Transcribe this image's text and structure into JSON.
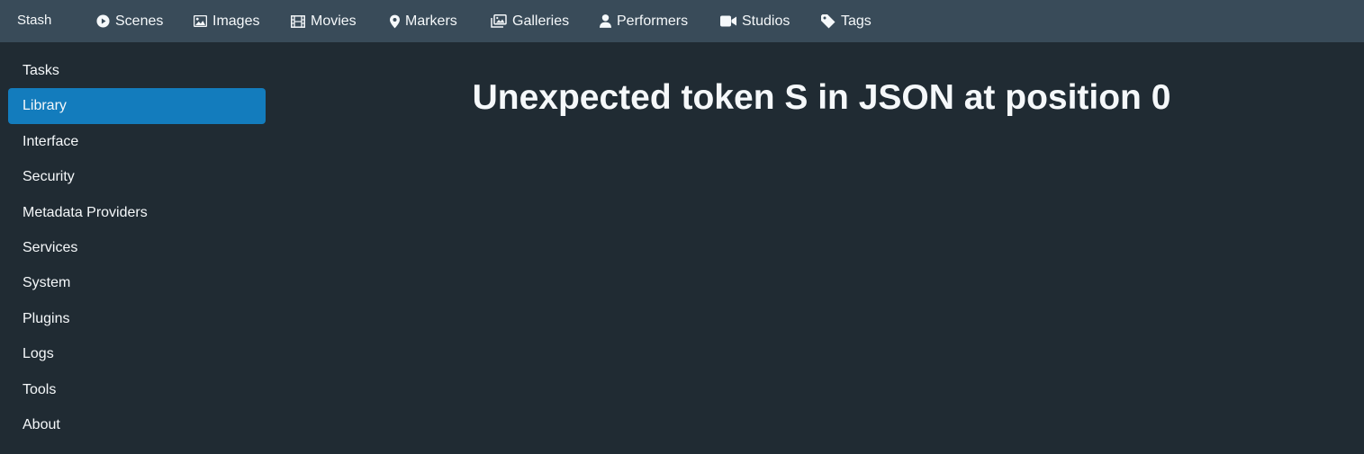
{
  "navbar": {
    "brand": "Stash",
    "items": [
      {
        "label": "Scenes",
        "icon": "play-circle-icon"
      },
      {
        "label": "Images",
        "icon": "image-icon"
      },
      {
        "label": "Movies",
        "icon": "film-icon"
      },
      {
        "label": "Markers",
        "icon": "map-marker-icon"
      },
      {
        "label": "Galleries",
        "icon": "images-icon"
      },
      {
        "label": "Performers",
        "icon": "user-icon"
      },
      {
        "label": "Studios",
        "icon": "video-camera-icon"
      },
      {
        "label": "Tags",
        "icon": "tag-icon"
      }
    ]
  },
  "sidebar": {
    "active": "Library",
    "items": [
      {
        "label": "Tasks"
      },
      {
        "label": "Library"
      },
      {
        "label": "Interface"
      },
      {
        "label": "Security"
      },
      {
        "label": "Metadata Providers"
      },
      {
        "label": "Services"
      },
      {
        "label": "System"
      },
      {
        "label": "Plugins"
      },
      {
        "label": "Logs"
      },
      {
        "label": "Tools"
      },
      {
        "label": "About"
      }
    ]
  },
  "main": {
    "error": "Unexpected token S in JSON at position 0"
  },
  "colors": {
    "background": "#202b33",
    "navbar": "#394b59",
    "active": "#137cbd",
    "text": "#f5f8fa"
  }
}
